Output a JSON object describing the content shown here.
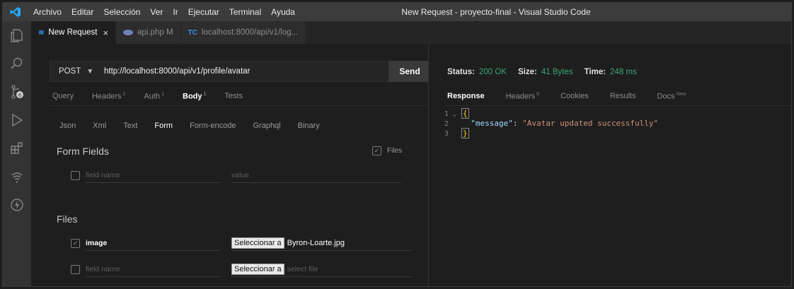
{
  "menu": [
    "Archivo",
    "Editar",
    "Selección",
    "Ver",
    "Ir",
    "Ejecutar",
    "Terminal",
    "Ayuda"
  ],
  "window_title": "New Request - proyecto-final - Visual Studio Code",
  "tabs": [
    {
      "label": "New Request",
      "close": "×"
    },
    {
      "label": "api.php M"
    },
    {
      "badge": "TC",
      "label": "localhost:8000/api/v1/log..."
    }
  ],
  "request": {
    "method": "POST",
    "url": "http://localhost:8000/api/v1/profile/avatar",
    "send_label": "Send",
    "tabs": [
      "Query",
      "Headers",
      "Auth",
      "Body",
      "Tests"
    ],
    "tab_counts": {
      "Headers": "2",
      "Auth": "1",
      "Body": "1"
    },
    "body_tabs": [
      "Json",
      "Xml",
      "Text",
      "Form",
      "Form-encode",
      "Graphql",
      "Binary"
    ],
    "form_fields_title": "Form Fields",
    "files_checkbox_label": "Files",
    "field_name_placeholder": "field name",
    "value_placeholder": "value",
    "files_title": "Files",
    "file_rows": [
      {
        "checked": true,
        "name": "image",
        "button": "Seleccionar a",
        "file": "Byron-Loarte.jpg"
      },
      {
        "checked": false,
        "name": "field name",
        "button": "Seleccionar a",
        "file": "select file"
      }
    ]
  },
  "response": {
    "status_label": "Status:",
    "status_value": "200 OK",
    "size_label": "Size:",
    "size_value": "41 Bytes",
    "time_label": "Time:",
    "time_value": "248 ms",
    "tabs": [
      "Response",
      "Headers",
      "Cookies",
      "Results",
      "Docs"
    ],
    "tab_counts": {
      "Headers": "6",
      "Docs": "New"
    },
    "code": {
      "line1": "1",
      "line2": "2",
      "line3": "3",
      "key": "\"message\"",
      "value": "\"Avatar updated successfully\""
    }
  },
  "colors": {
    "accent_green": "#3aa675",
    "activity_bg": "#333333",
    "titlebar_bg": "#3c3c3c"
  }
}
